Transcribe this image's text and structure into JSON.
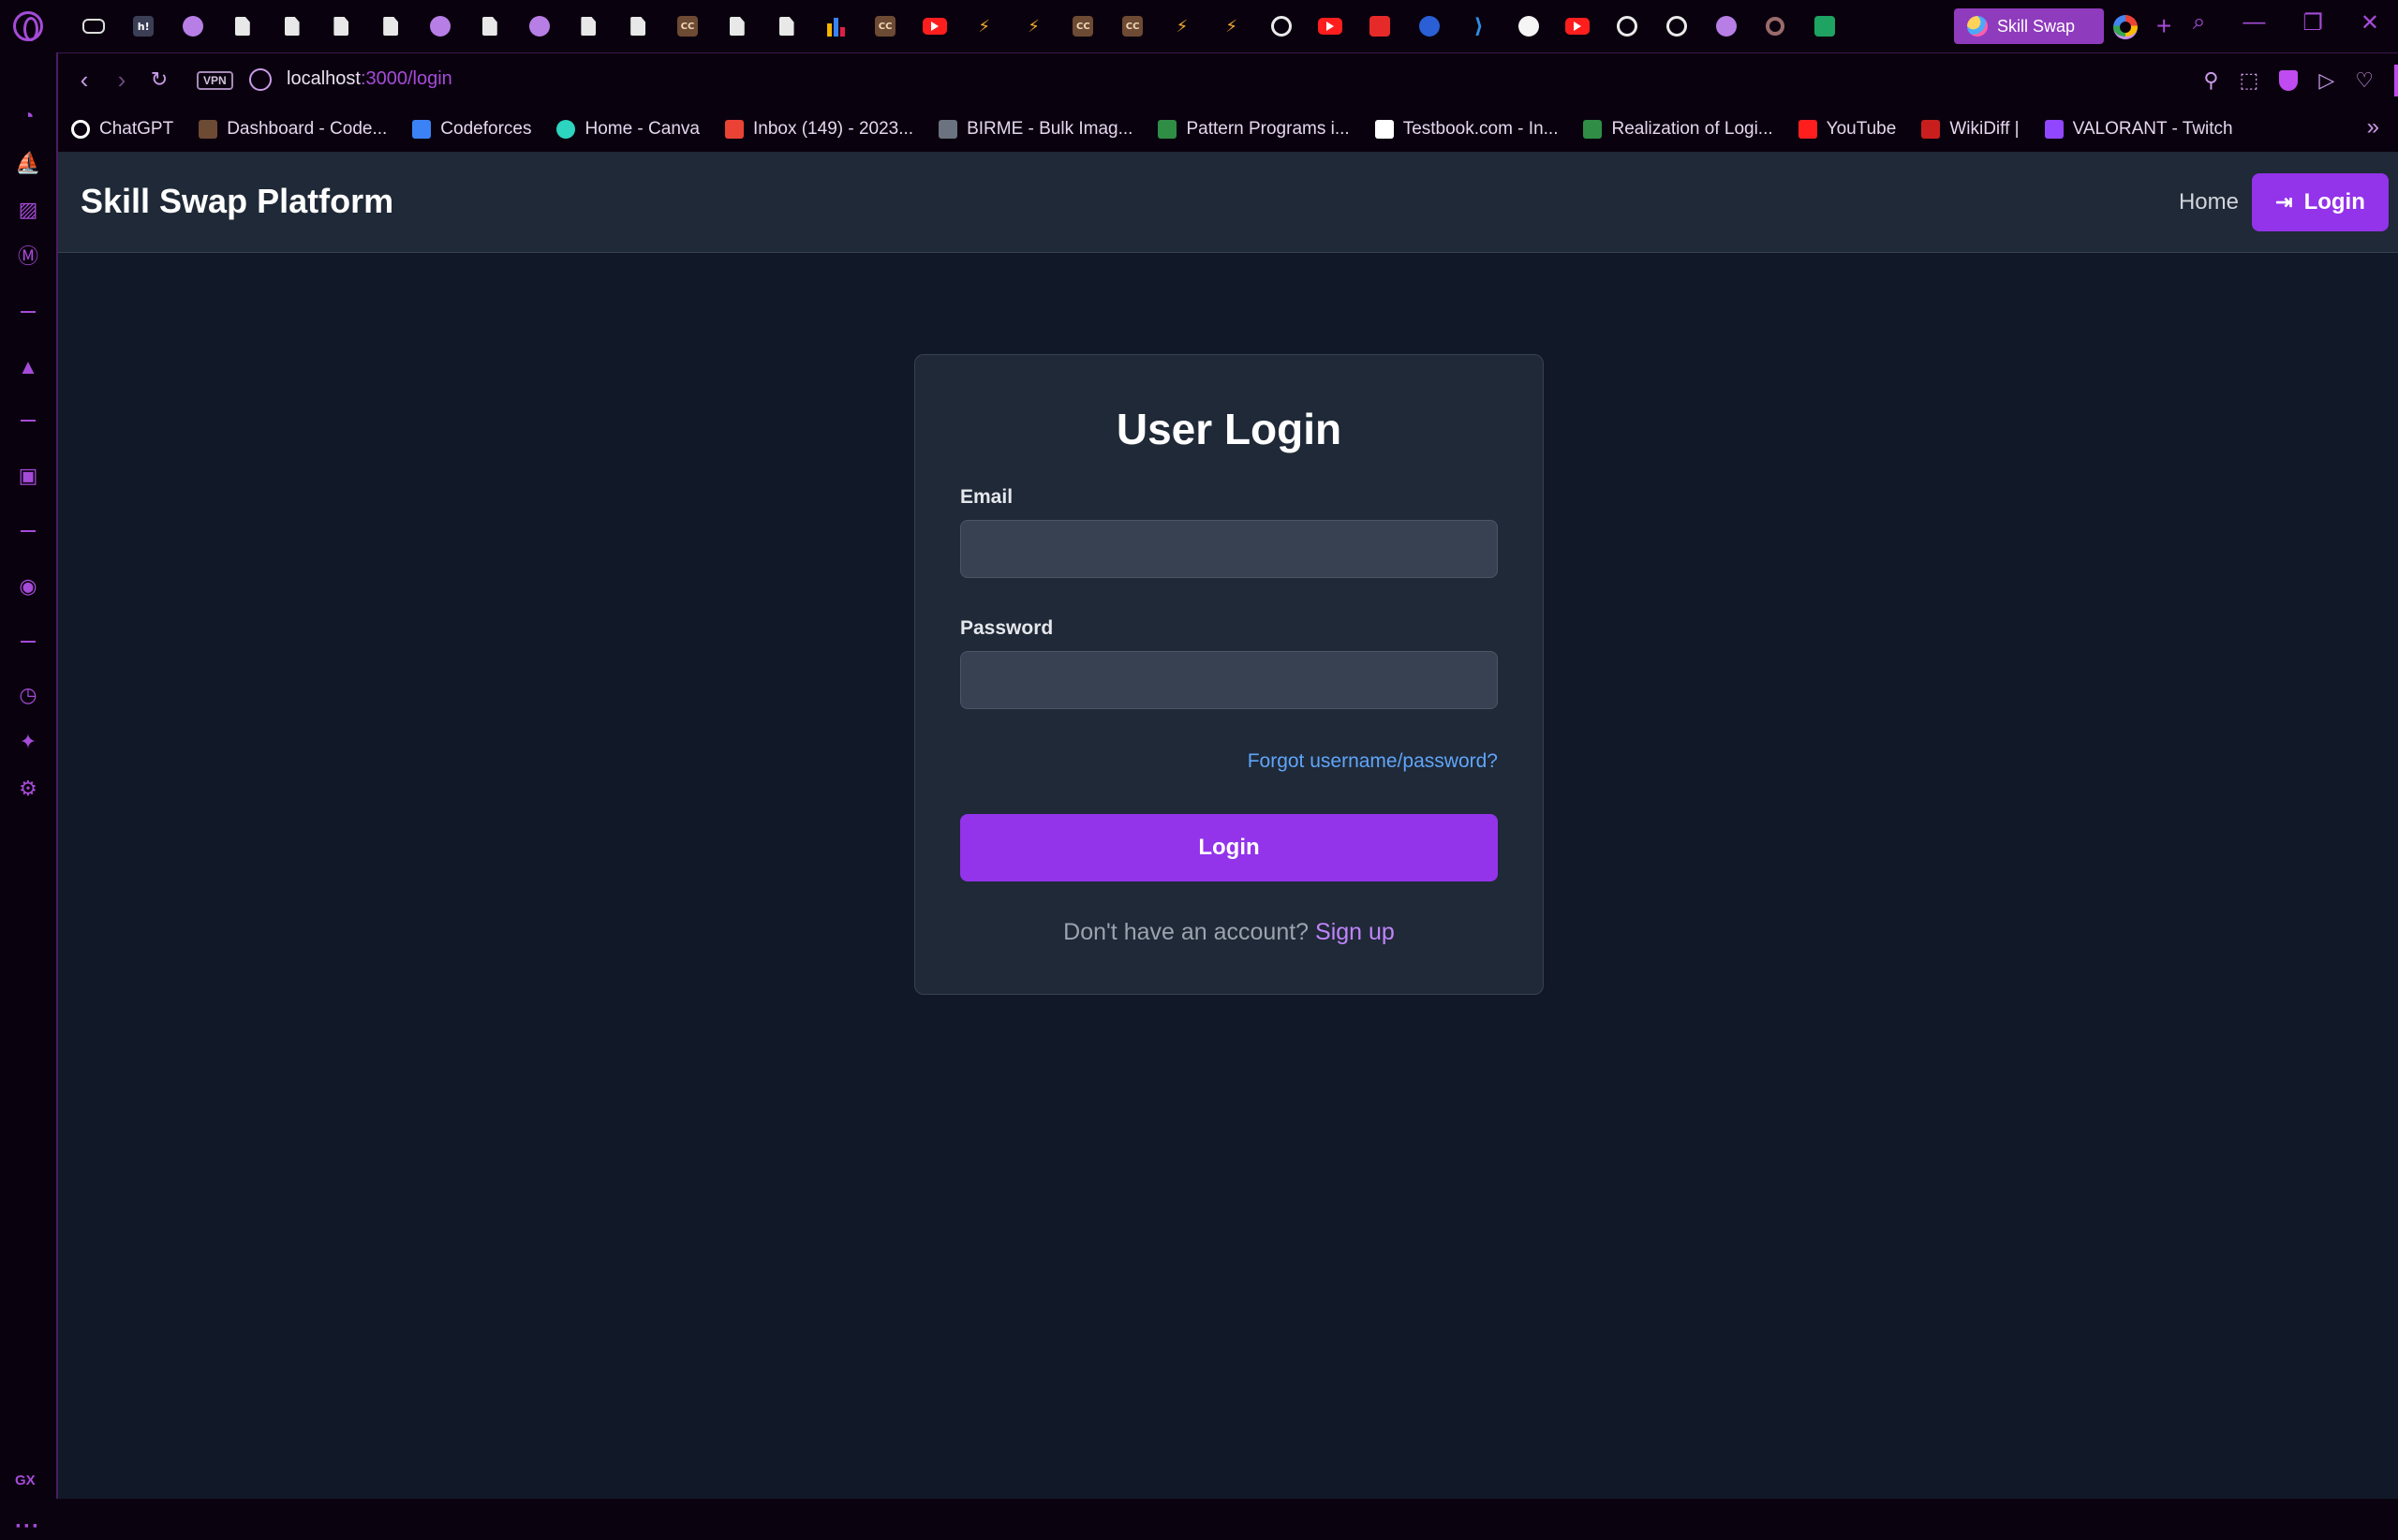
{
  "browser": {
    "active_tab_title": "Skill Swap",
    "url_host": "localhost",
    "url_path": ":3000/login",
    "vpn_label": "VPN",
    "accent_color": "#a54bd8",
    "tab_icons": [
      "gamepad-icon",
      "hb-icon",
      "globe-icon",
      "doc-icon",
      "doc-icon",
      "doc-icon",
      "doc-icon",
      "globe-icon",
      "doc-icon",
      "globe-icon",
      "doc-icon",
      "doc-icon",
      "cc-icon",
      "doc-icon",
      "doc-icon",
      "bar-chart-icon",
      "cc-icon",
      "youtube-icon",
      "leetcode-icon",
      "leetcode-icon",
      "cc-icon",
      "cc-icon",
      "leetcode-icon",
      "leetcode-icon",
      "chatgpt-icon",
      "youtube-icon",
      "red-icon",
      "badge-icon",
      "vscode-icon",
      "github-icon",
      "youtube-icon",
      "chatgpt-icon",
      "chatgpt-icon",
      "globe-icon",
      "ring-icon",
      "meet-icon"
    ],
    "sidebar_gx_label": "GX",
    "sidebar_more_label": "···"
  },
  "bookmarks": [
    {
      "label": "ChatGPT",
      "icon": "chatgpt-icon",
      "color": "#ffffff"
    },
    {
      "label": "Dashboard - Code...",
      "icon": "cc-icon",
      "color": "#6d4a33"
    },
    {
      "label": "Codeforces",
      "icon": "bar-chart-icon",
      "color": "#3b82f6"
    },
    {
      "label": "Home - Canva",
      "icon": "canva-icon",
      "color": "#2dd4bf"
    },
    {
      "label": "Inbox (149) - 2023...",
      "icon": "gmail-icon",
      "color": "#ea4335"
    },
    {
      "label": "BIRME - Bulk Imag...",
      "icon": "birme-icon",
      "color": "#6b7280"
    },
    {
      "label": "Pattern Programs i...",
      "icon": "gfg-icon",
      "color": "#2f8d46"
    },
    {
      "label": "Testbook.com - In...",
      "icon": "testbook-icon",
      "color": "#ffffff"
    },
    {
      "label": "Realization of Logi...",
      "icon": "gfg-icon",
      "color": "#2f8d46"
    },
    {
      "label": "YouTube",
      "icon": "youtube-icon",
      "color": "#ff1e1e"
    },
    {
      "label": "WikiDiff |",
      "icon": "wikidiff-icon",
      "color": "#c81e1e"
    },
    {
      "label": "VALORANT - Twitch",
      "icon": "twitch-icon",
      "color": "#9146ff"
    }
  ],
  "app": {
    "brand": "Skill Swap Platform",
    "nav_home": "Home",
    "nav_login": "Login",
    "primary_color": "#9333ea"
  },
  "login_form": {
    "title": "User Login",
    "email_label": "Email",
    "email_value": "",
    "password_label": "Password",
    "password_value": "",
    "forgot_link": "Forgot username/password?",
    "submit_label": "Login",
    "signup_prompt": "Don't have an account?",
    "signup_link": "Sign up"
  }
}
